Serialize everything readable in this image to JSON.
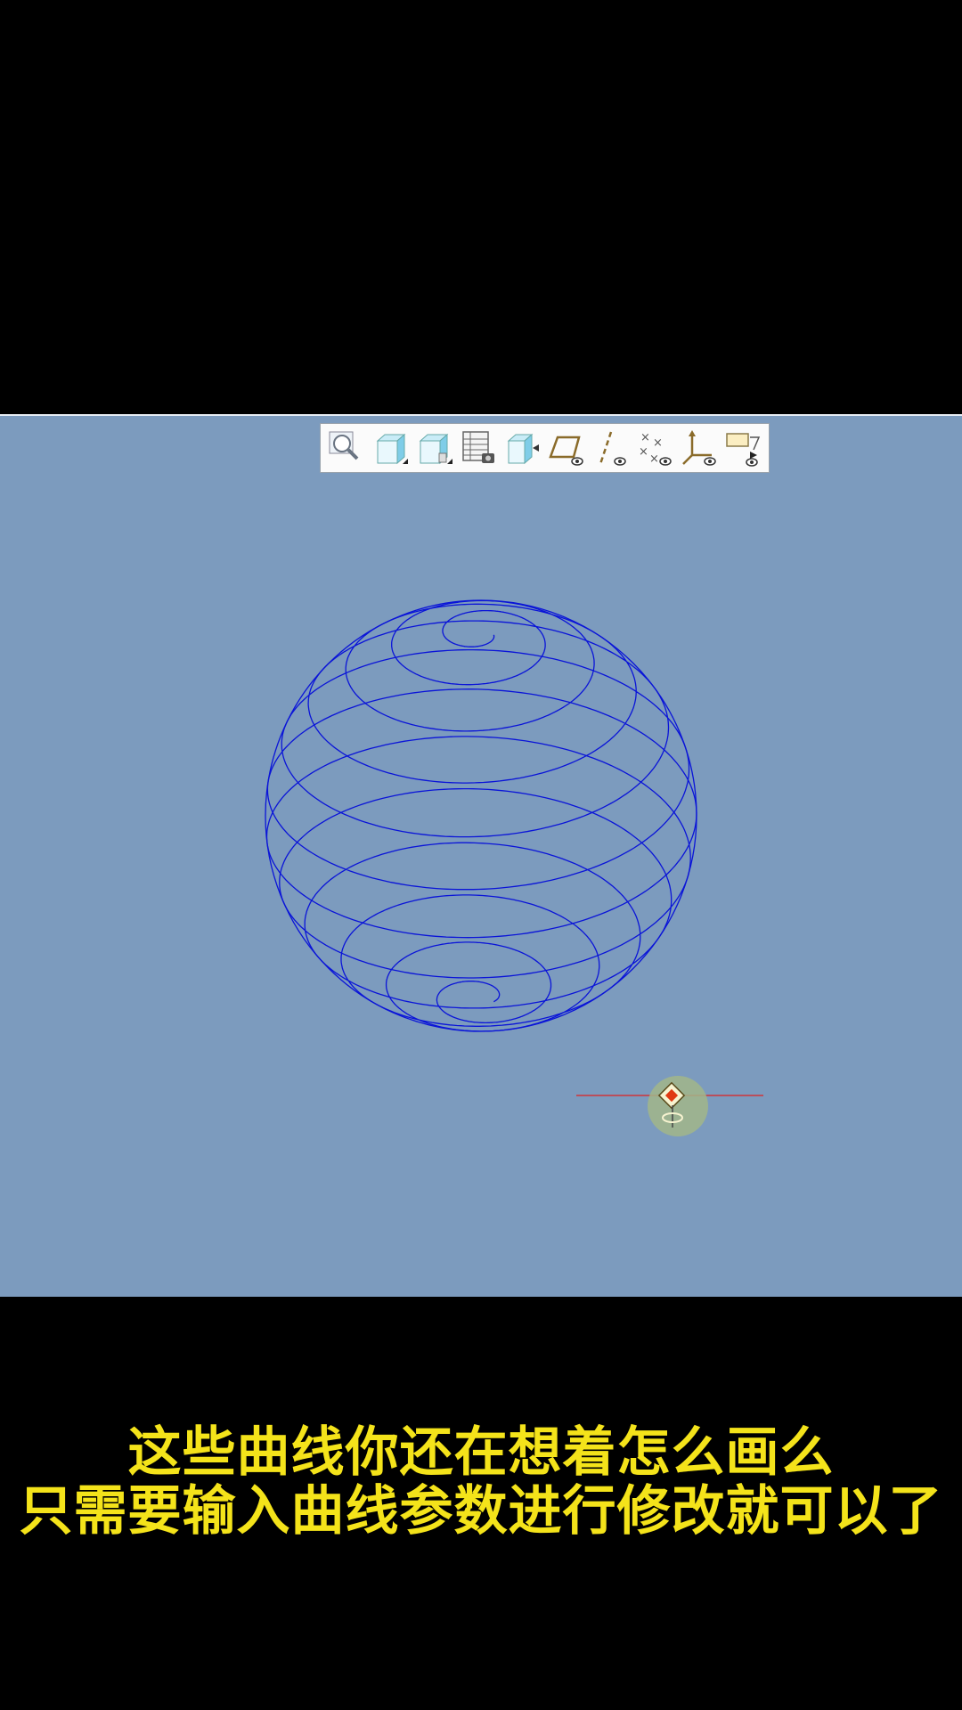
{
  "toolbar": {
    "buttons": [
      {
        "icon": "zoom-magnifier-icon"
      },
      {
        "icon": "view-cube-icon"
      },
      {
        "icon": "saved-view-icon"
      },
      {
        "icon": "layer-table-icon"
      },
      {
        "icon": "reorient-cube-icon"
      },
      {
        "icon": "datum-plane-display-icon"
      },
      {
        "icon": "datum-axis-display-icon"
      },
      {
        "icon": "datum-point-display-icon"
      },
      {
        "icon": "coordinate-system-display-icon"
      },
      {
        "icon": "annotation-display-icon"
      }
    ]
  },
  "viewport": {
    "background_color": "#7c9bbe",
    "curve_color": "#0a14d8",
    "axis_color": "#e02020"
  },
  "captions": {
    "line1": "这些曲线你还在想着怎么画么",
    "line2": "只需要输入曲线参数进行修改就可以了",
    "color": "#f4e31a"
  }
}
